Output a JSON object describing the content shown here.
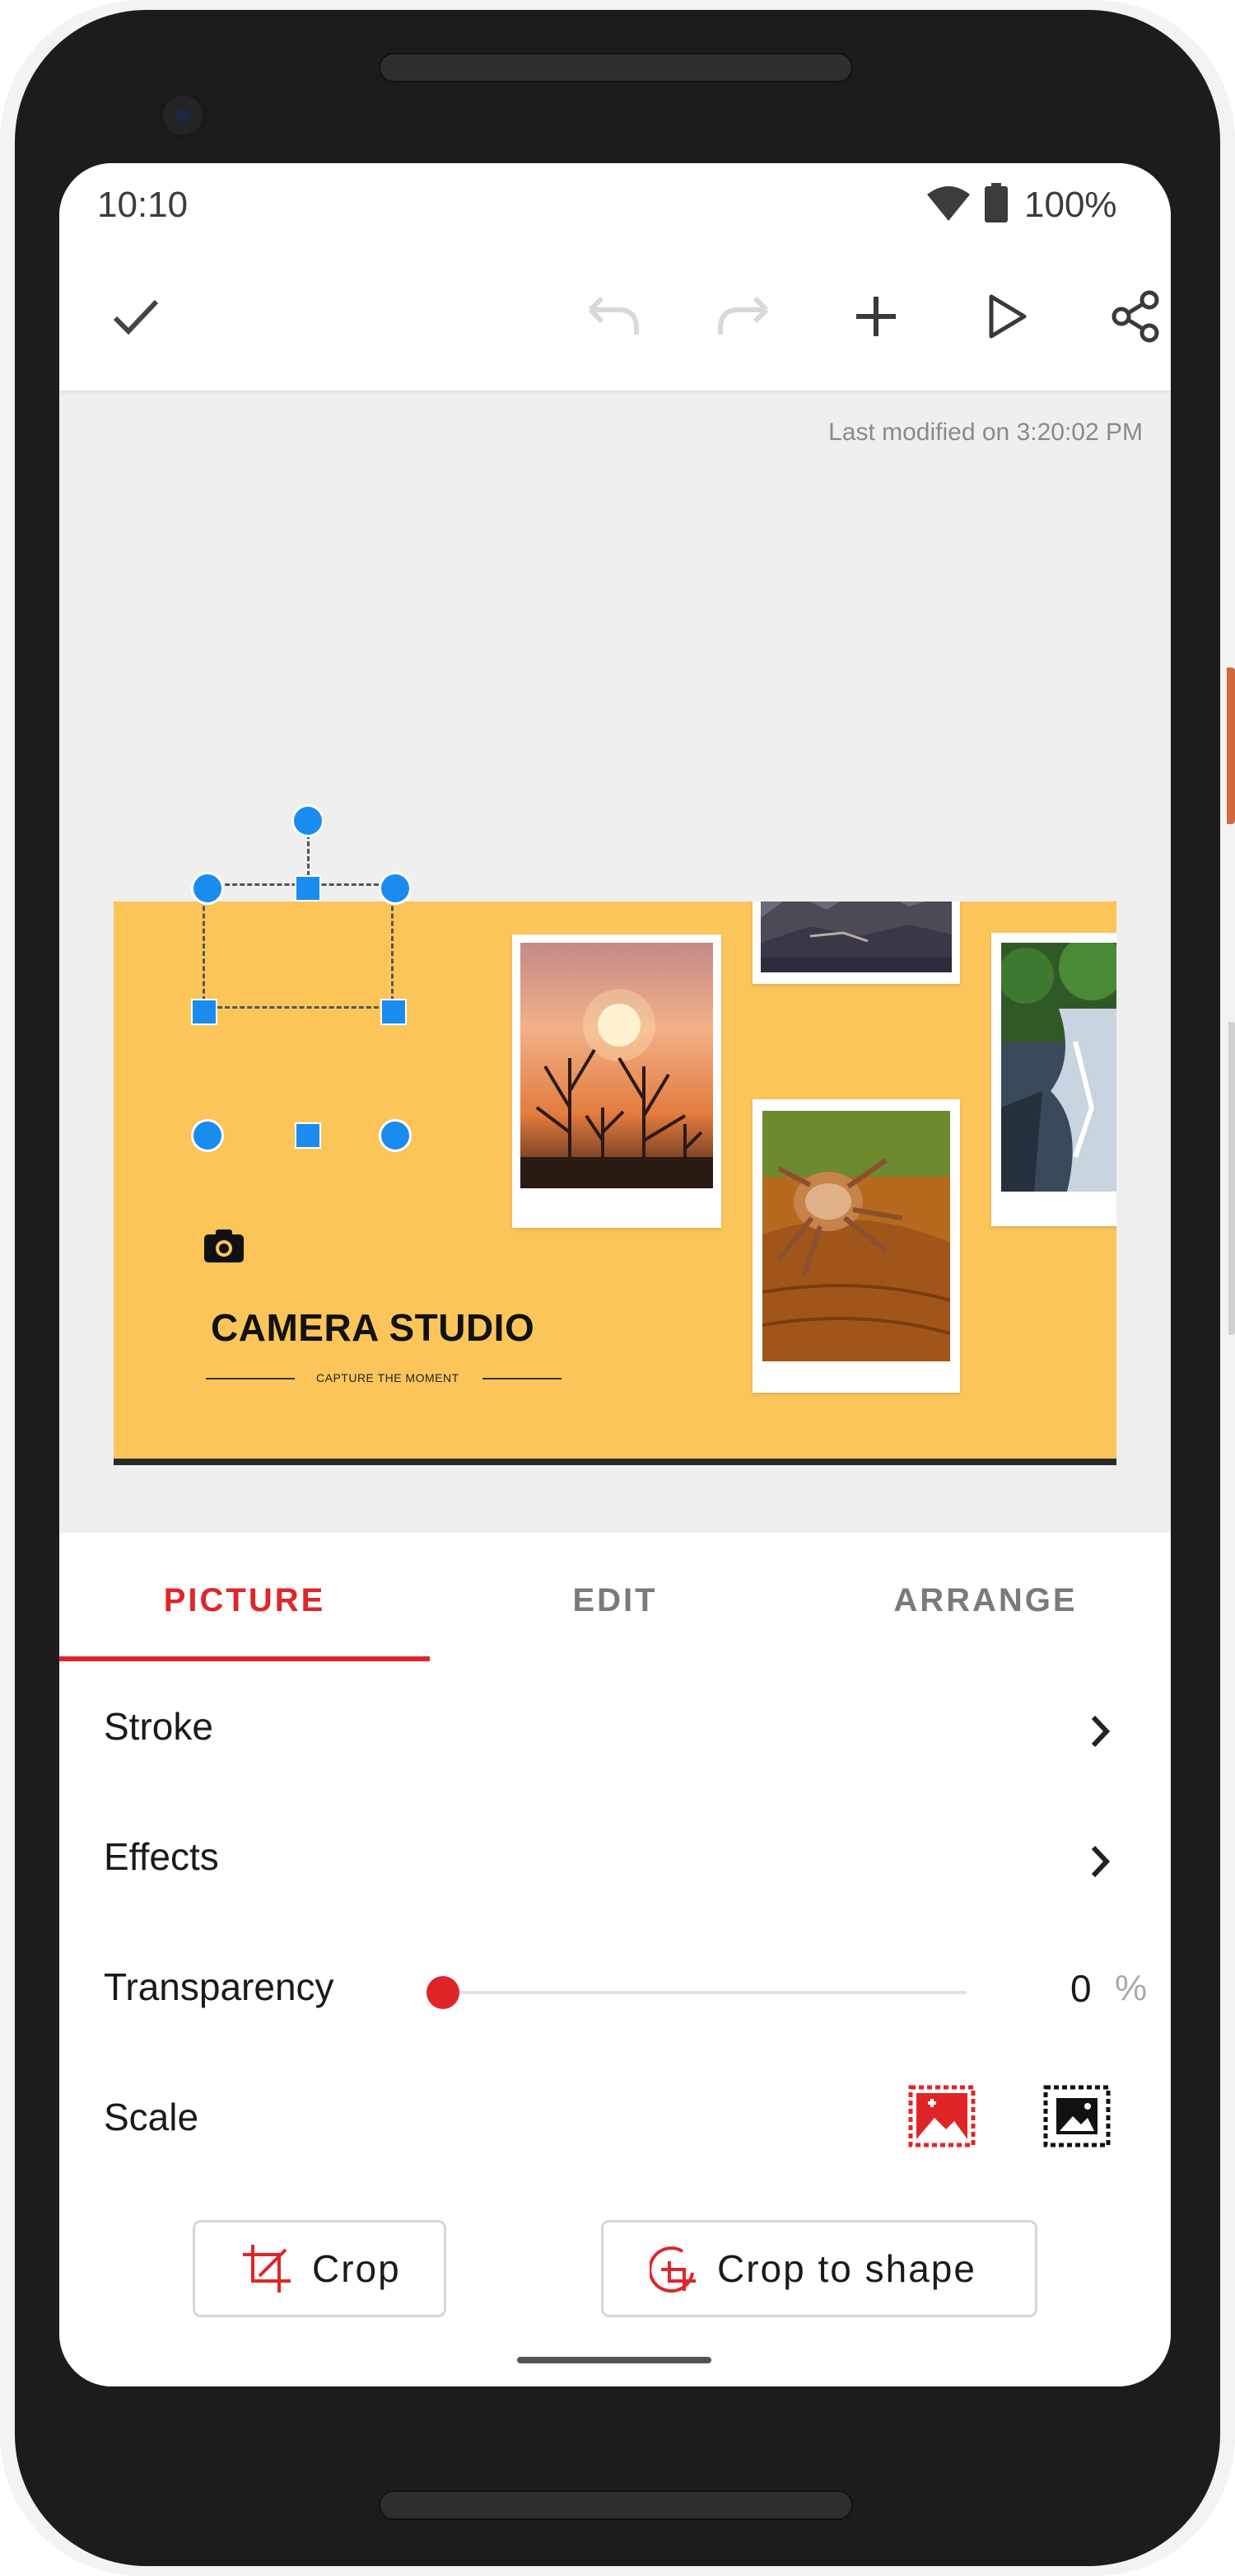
{
  "status_bar": {
    "time": "10:10",
    "battery": "100%"
  },
  "toolbar": {
    "done_icon": "check-icon",
    "undo_icon": "undo-icon",
    "redo_icon": "redo-icon",
    "add_icon": "plus-icon",
    "play_icon": "play-icon",
    "share_icon": "share-icon"
  },
  "canvas": {
    "last_modified": "Last modified on 3:20:02 PM",
    "slide": {
      "title": "CAMERA STUDIO",
      "subtitle": "CAPTURE THE MOMENT",
      "background_color": "#fbc55a"
    }
  },
  "tabs": [
    {
      "label": "PICTURE",
      "active": true
    },
    {
      "label": "EDIT",
      "active": false
    },
    {
      "label": "ARRANGE",
      "active": false
    }
  ],
  "picture_panel": {
    "stroke_label": "Stroke",
    "effects_label": "Effects",
    "transparency_label": "Transparency",
    "transparency_value": "0",
    "transparency_unit": "%",
    "transparency_fraction": 0,
    "scale_label": "Scale",
    "crop_label": "Crop",
    "crop_to_shape_label": "Crop to shape"
  },
  "colors": {
    "accent": "#e02528",
    "selection_handle": "#1a8cf0"
  }
}
